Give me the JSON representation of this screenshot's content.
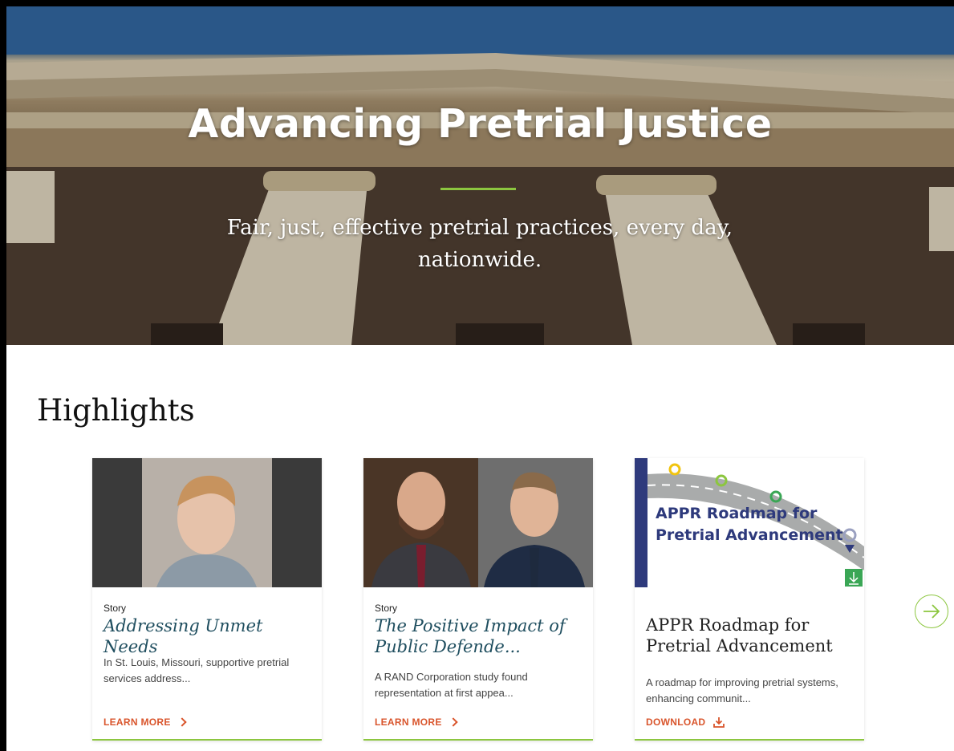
{
  "hero": {
    "title": "Advancing Pretrial Justice",
    "subtitle": "Fair, just, effective pretrial practices, every day, nationwide."
  },
  "highlights": {
    "title": "Highlights",
    "cards": [
      {
        "type": "Story",
        "title": "Addressing Unmet Needs",
        "description": "In St. Louis, Missouri, supportive pretrial services address...",
        "link": "LEARN MORE"
      },
      {
        "type": "Story",
        "title": "The Positive Impact of Public Defende...",
        "description": "A RAND Corporation study found representation at first appea...",
        "link": "LEARN MORE"
      },
      {
        "type": "",
        "title": "APPR Roadmap for Pretrial Advancement",
        "description": "A roadmap for improving pretrial systems, enhancing communit...",
        "link": "DOWNLOAD",
        "image_text": "APPR Roadmap for Pretrial Advancement"
      }
    ]
  },
  "colors": {
    "accent_green": "#8cc63f",
    "link_orange": "#d9552c",
    "title_teal": "#1f4e5f"
  },
  "icons": {
    "next": "arrow-right-circle-icon",
    "link": "chevron-right-icon",
    "download": "download-icon"
  }
}
